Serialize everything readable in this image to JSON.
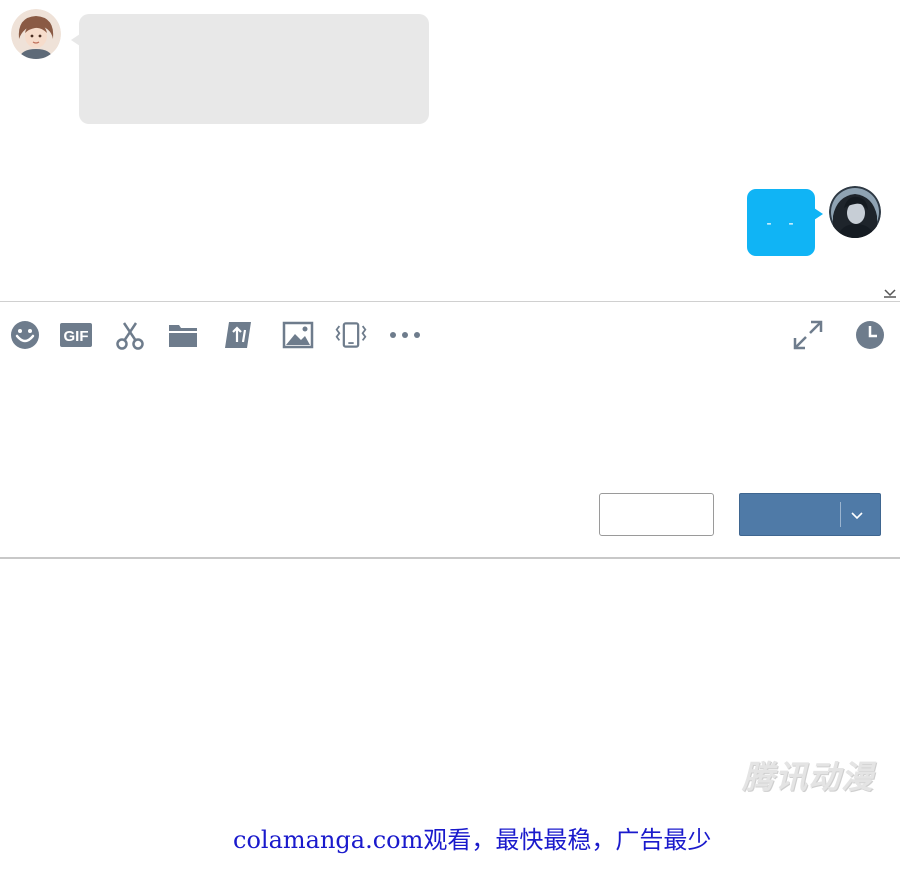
{
  "chat": {
    "incoming": {
      "avatar_icon": "woman-avatar-icon",
      "bubble_color": "#e8e8e8",
      "text": ""
    },
    "outgoing": {
      "avatar_icon": "man-avatar-icon",
      "bubble_color": "#10b4f5",
      "text": "- -"
    },
    "collapse_icon": "collapse-icon"
  },
  "toolbar": {
    "left_icons": [
      "emoji-icon",
      "gif-icon",
      "scissors-icon",
      "folder-icon",
      "red-packet-icon",
      "image-icon",
      "shake-icon",
      "more-icon"
    ],
    "gif_label": "GIF",
    "more_label": "•••",
    "right_icons": [
      "expand-icon",
      "history-icon"
    ]
  },
  "composer": {
    "text": "",
    "close_button_label": "",
    "send_button_label": "",
    "send_button_color": "#4f7aa7",
    "send_dropdown_icon": "chevron-down-icon"
  },
  "watermark": {
    "text": "腾讯动漫"
  },
  "footer": {
    "text": "colamanga.com观看，最快最稳，广告最少",
    "color": "#1a1acc"
  }
}
